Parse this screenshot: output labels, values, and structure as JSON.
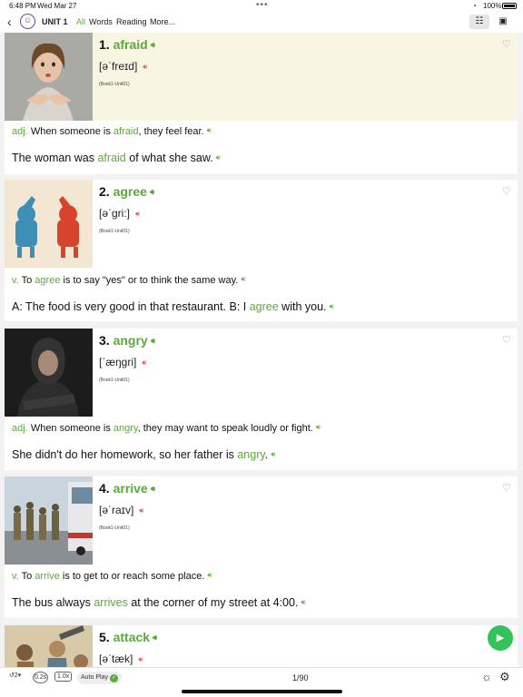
{
  "status": {
    "time": "6:48 PM",
    "date": "Wed Mar 27",
    "battery": "100%"
  },
  "nav": {
    "unit": "UNIT 1",
    "tabs": [
      {
        "label": "All",
        "active": true
      },
      {
        "label": "Words",
        "active": false
      },
      {
        "label": "Reading",
        "active": false
      },
      {
        "label": "More...",
        "active": false
      }
    ]
  },
  "cards": [
    {
      "index": "1.",
      "word": "afraid",
      "ipa": "[əˈfreɪd]",
      "ref": "(Book1-Unit01)",
      "pos": "adj.",
      "def_before": "When someone is ",
      "def_word": "afraid",
      "def_after": ", they feel fear.",
      "ex_before": "The woman was ",
      "ex_word": "afraid",
      "ex_after": " of what she saw."
    },
    {
      "index": "2.",
      "word": "agree",
      "ipa": "[əˈgri:]",
      "ref": "(Book1-Unit01)",
      "pos": "v.",
      "def_before": "To ",
      "def_word": "agree",
      "def_after": " is to say \"yes\" or to think the same way.",
      "ex_before": "A: The food is very good in that restaurant. B: I ",
      "ex_word": "agree",
      "ex_after": " with you."
    },
    {
      "index": "3.",
      "word": "angry",
      "ipa": "[ˈæŋgri]",
      "ref": "(Book1-Unit01)",
      "pos": "adj.",
      "def_before": "When someone is ",
      "def_word": "angry",
      "def_after": ", they may want to speak loudly or fight.",
      "ex_before": "She didn't do her homework, so her father is ",
      "ex_word": "angry",
      "ex_after": "."
    },
    {
      "index": "4.",
      "word": "arrive",
      "ipa": "[əˈraɪv]",
      "ref": "(Book1-Unit01)",
      "pos": "v.",
      "def_before": "To ",
      "def_word": "arrive",
      "def_after": " is to get to or reach some place.",
      "ex_before": "The bus always ",
      "ex_word": "arrives",
      "ex_after": " at the corner of my street at 4:00."
    },
    {
      "index": "5.",
      "word": "attack",
      "ipa": "[əˈtæk]"
    }
  ],
  "toolbar": {
    "repeat": "2",
    "delay": "0.2s",
    "speed": "1.0x",
    "autoplay": "Auto Play",
    "pager": "1/90"
  },
  "colors": {
    "accent_green": "#5aaa3a",
    "speaker_red": "#e24a3b",
    "highlight_bg": "#f8f5e3",
    "fab_green": "#34c35a"
  },
  "icons": {
    "speaker_green": "speaker-icon",
    "speaker_red": "speaker-icon",
    "favorite": "heart-outline-icon",
    "list_view": "list-view-icon",
    "card_view": "card-view-icon",
    "play": "play-icon",
    "brightness": "brightness-icon",
    "settings": "gear-icon"
  }
}
